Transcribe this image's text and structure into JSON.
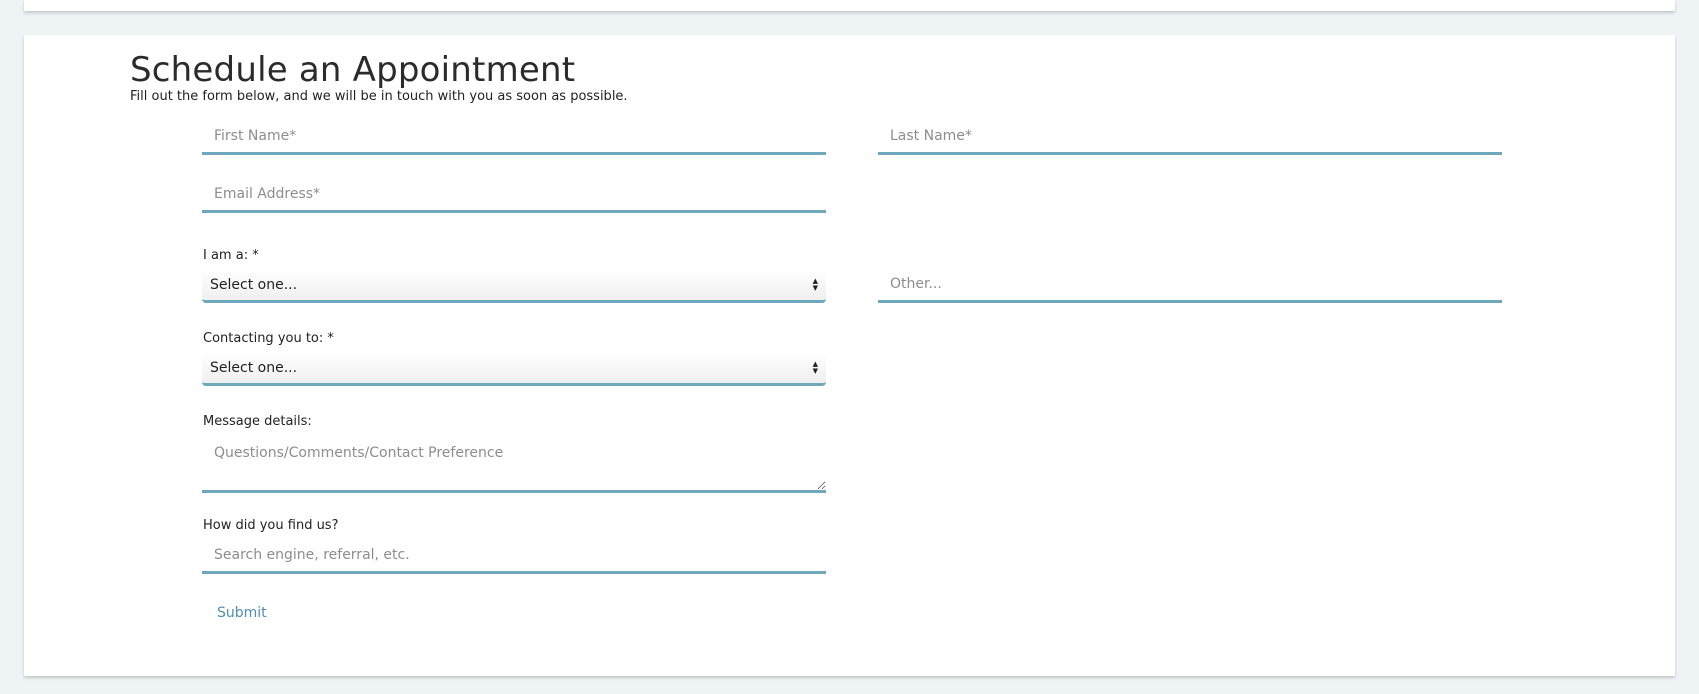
{
  "form": {
    "title": "Schedule an Appointment",
    "subtitle": "Fill out the form below, and we will be in touch with you as soon as possible.",
    "first_name": {
      "placeholder": "First Name*",
      "value": ""
    },
    "last_name": {
      "placeholder": "Last Name*",
      "value": ""
    },
    "email": {
      "placeholder": "Email Address*",
      "value": ""
    },
    "role": {
      "label": "I am a: *",
      "selected": "Select one..."
    },
    "other": {
      "placeholder": "Other...",
      "value": ""
    },
    "purpose": {
      "label": "Contacting you to: *",
      "selected": "Select one..."
    },
    "message": {
      "label": "Message details:",
      "placeholder": "Questions/Comments/Contact Preference"
    },
    "referral": {
      "label": "How did you find us?",
      "placeholder": "Search engine, referral, etc."
    },
    "submit_label": "Submit"
  },
  "theme": {
    "accent": "#6fa7bb",
    "link": "#4f8eae",
    "background": "#eef3f6",
    "card": "#ffffff"
  },
  "icons": {
    "select_arrows": "select-arrows-icon"
  }
}
